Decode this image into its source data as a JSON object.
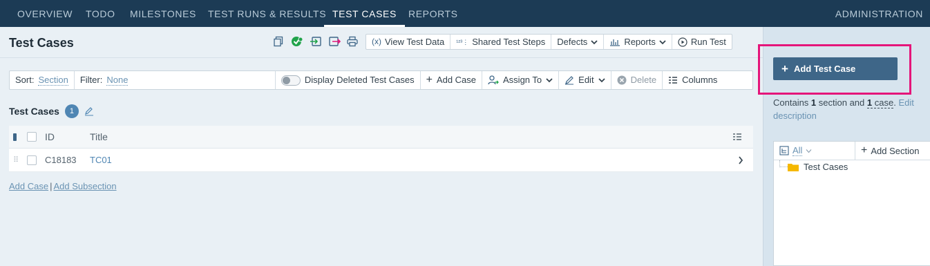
{
  "nav": {
    "tabs": [
      {
        "label": "OVERVIEW"
      },
      {
        "label": "TODO"
      },
      {
        "label": "MILESTONES"
      },
      {
        "label": "TEST RUNS & RESULTS"
      },
      {
        "label": "TEST CASES"
      },
      {
        "label": "REPORTS"
      }
    ],
    "active_tab": "TEST CASES",
    "admin": "ADMINISTRATION"
  },
  "page": {
    "title": "Test Cases"
  },
  "toolbar": {
    "icons": [
      "copy-icon",
      "sync-icon",
      "import-icon",
      "export-icon",
      "print-icon"
    ],
    "view_test_data": "View Test Data",
    "shared_test_steps": "Shared Test Steps",
    "defects": "Defects",
    "reports": "Reports",
    "run_test": "Run Test"
  },
  "filterbar": {
    "sort_label": "Sort:",
    "sort_value": "Section",
    "filter_label": "Filter:",
    "filter_value": "None",
    "display_deleted": "Display Deleted Test Cases",
    "add_case": "Add Case",
    "assign_to": "Assign To",
    "edit": "Edit",
    "delete": "Delete",
    "columns": "Columns"
  },
  "section": {
    "title": "Test Cases",
    "count": "1"
  },
  "table": {
    "columns": [
      "ID",
      "Title"
    ],
    "rows": [
      {
        "id": "C18183",
        "title": "TC01"
      }
    ]
  },
  "bottom_links": {
    "add_case": "Add Case",
    "separator": "|",
    "add_subsection": "Add Subsection"
  },
  "sidebar": {
    "add_test_case": "Add Test Case",
    "contains_prefix": "Contains ",
    "sections_count": "1",
    "sections_word": " section and ",
    "cases_count": "1",
    "cases_word": " case",
    "period": ".",
    "edit_description": "Edit description",
    "tree_filter": "All",
    "add_section": "Add Section",
    "tree_node": "Test Cases"
  },
  "colors": {
    "nav_bg": "#1c3b55",
    "primary_button": "#3e6688",
    "highlight": "#e5157a",
    "link": "#6a93b3",
    "badge": "#4f86b3"
  }
}
